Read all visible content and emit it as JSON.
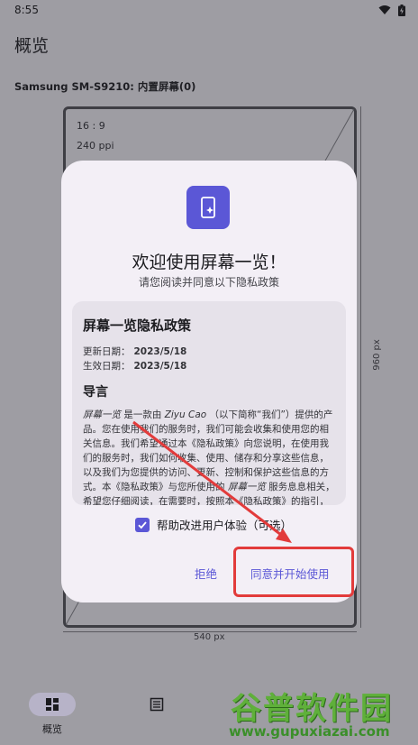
{
  "status_bar": {
    "time": "8:55"
  },
  "page": {
    "title": "概览",
    "device_title": "Samsung SM-S9210: 内置屏幕(0)",
    "specs": [
      "16 : 9",
      "240 ppi"
    ],
    "height_label": "960 px",
    "width_label": "540 px"
  },
  "dialog": {
    "title": "欢迎使用屏幕一览！",
    "subtitle": "请您阅读并同意以下隐私政策",
    "policy": {
      "title": "屏幕一览隐私政策",
      "updated_label": "更新日期：",
      "updated_value": "2023/5/18",
      "effective_label": "生效日期：",
      "effective_value": "2023/5/18",
      "section": "导言",
      "p1_app": "屏幕一览",
      "p1_mid": " 是一款由 ",
      "p1_author": "Ziyu Cao",
      "p1_rest": " （以下简称“我们”）提供的产品。您在使用我们的服务时，我们可能会收集和使用您的相关信息。我们希望通过本《隐私政策》向您说明，在使用我们的服务时，我们如何收集、使用、储存和分享这些信息，以及我们为您提供的访问、更新、控制和保护这些信息的方式。本《隐私政策》与您所使用的 ",
      "p1_app2": "屏幕一览",
      "p1_tail": " 服务息息相关，希望您仔细阅读，在需要时，按照本《隐私政策》的指引，作出您认为适当的选择。本《隐私政策》中涉及的相关技术词汇，我们尽量"
    },
    "consent_label": "帮助改进用户体验（可选）",
    "decline_label": "拒绝",
    "accept_label": "同意并开始使用"
  },
  "bottom_nav": {
    "items": [
      {
        "label": "概览",
        "icon": "dashboard-icon"
      },
      {
        "label": "",
        "icon": "list-icon"
      }
    ]
  },
  "watermark": {
    "big": "谷普软件园",
    "small": "www.gupuxiazai.com"
  },
  "colors": {
    "accent": "#5b57d6",
    "annotation": "#e23b3b",
    "dialog_bg": "#f3eff6"
  }
}
